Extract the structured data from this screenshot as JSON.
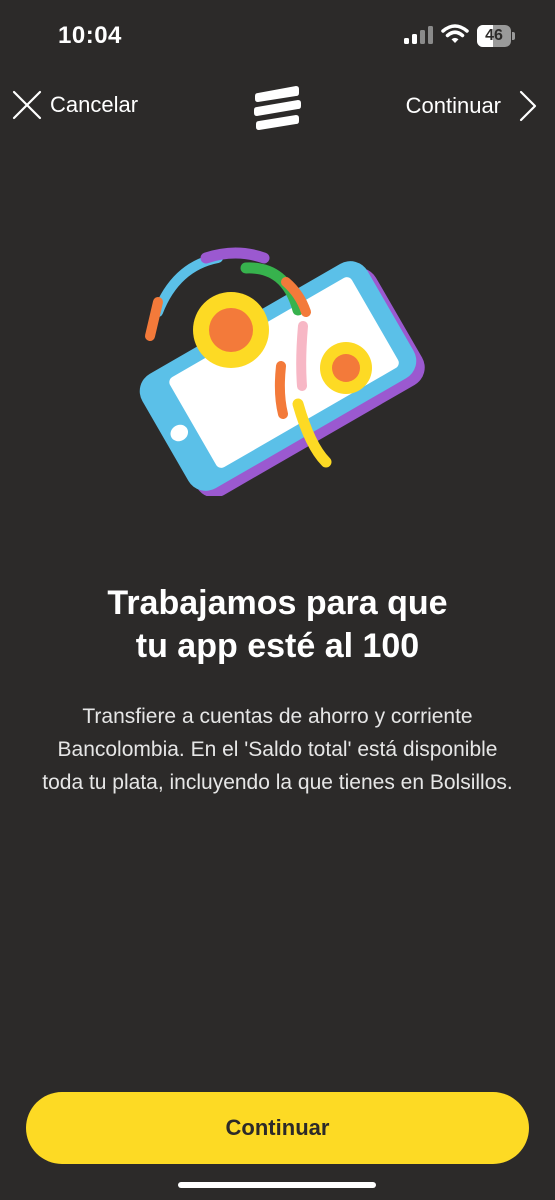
{
  "status_bar": {
    "time": "10:04",
    "battery_percent": "46",
    "battery_level": 0.46,
    "signal_icon": "cellular-signal-icon",
    "wifi_icon": "wifi-icon"
  },
  "nav": {
    "cancel_label": "Cancelar",
    "cancel_icon": "close-icon",
    "logo_icon": "bancolombia-logo",
    "continue_label": "Continuar",
    "continue_icon": "chevron-right-icon"
  },
  "illustration": {
    "icon": "phone-illustration"
  },
  "content": {
    "title_line1": "Trabajamos para que",
    "title_line2": "tu app esté al 100",
    "description": "Transfiere a cuentas de ahorro y corriente Bancolombia. En el 'Saldo total' está disponible toda tu plata, incluyendo la que tienes en Bolsillos."
  },
  "footer": {
    "button_label": "Continuar"
  },
  "colors": {
    "background": "#2c2a29",
    "accent_yellow": "#fdda24",
    "text": "#ffffff"
  }
}
